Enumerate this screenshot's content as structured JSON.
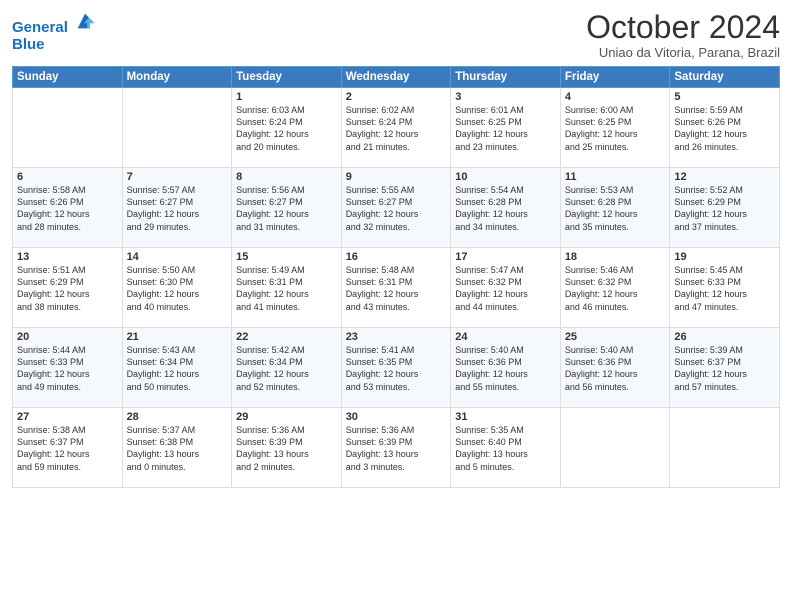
{
  "logo": {
    "line1": "General",
    "line2": "Blue"
  },
  "title": "October 2024",
  "subtitle": "Uniao da Vitoria, Parana, Brazil",
  "days_of_week": [
    "Sunday",
    "Monday",
    "Tuesday",
    "Wednesday",
    "Thursday",
    "Friday",
    "Saturday"
  ],
  "weeks": [
    [
      {
        "day": "",
        "content": ""
      },
      {
        "day": "",
        "content": ""
      },
      {
        "day": "1",
        "content": "Sunrise: 6:03 AM\nSunset: 6:24 PM\nDaylight: 12 hours\nand 20 minutes."
      },
      {
        "day": "2",
        "content": "Sunrise: 6:02 AM\nSunset: 6:24 PM\nDaylight: 12 hours\nand 21 minutes."
      },
      {
        "day": "3",
        "content": "Sunrise: 6:01 AM\nSunset: 6:25 PM\nDaylight: 12 hours\nand 23 minutes."
      },
      {
        "day": "4",
        "content": "Sunrise: 6:00 AM\nSunset: 6:25 PM\nDaylight: 12 hours\nand 25 minutes."
      },
      {
        "day": "5",
        "content": "Sunrise: 5:59 AM\nSunset: 6:26 PM\nDaylight: 12 hours\nand 26 minutes."
      }
    ],
    [
      {
        "day": "6",
        "content": "Sunrise: 5:58 AM\nSunset: 6:26 PM\nDaylight: 12 hours\nand 28 minutes."
      },
      {
        "day": "7",
        "content": "Sunrise: 5:57 AM\nSunset: 6:27 PM\nDaylight: 12 hours\nand 29 minutes."
      },
      {
        "day": "8",
        "content": "Sunrise: 5:56 AM\nSunset: 6:27 PM\nDaylight: 12 hours\nand 31 minutes."
      },
      {
        "day": "9",
        "content": "Sunrise: 5:55 AM\nSunset: 6:27 PM\nDaylight: 12 hours\nand 32 minutes."
      },
      {
        "day": "10",
        "content": "Sunrise: 5:54 AM\nSunset: 6:28 PM\nDaylight: 12 hours\nand 34 minutes."
      },
      {
        "day": "11",
        "content": "Sunrise: 5:53 AM\nSunset: 6:28 PM\nDaylight: 12 hours\nand 35 minutes."
      },
      {
        "day": "12",
        "content": "Sunrise: 5:52 AM\nSunset: 6:29 PM\nDaylight: 12 hours\nand 37 minutes."
      }
    ],
    [
      {
        "day": "13",
        "content": "Sunrise: 5:51 AM\nSunset: 6:29 PM\nDaylight: 12 hours\nand 38 minutes."
      },
      {
        "day": "14",
        "content": "Sunrise: 5:50 AM\nSunset: 6:30 PM\nDaylight: 12 hours\nand 40 minutes."
      },
      {
        "day": "15",
        "content": "Sunrise: 5:49 AM\nSunset: 6:31 PM\nDaylight: 12 hours\nand 41 minutes."
      },
      {
        "day": "16",
        "content": "Sunrise: 5:48 AM\nSunset: 6:31 PM\nDaylight: 12 hours\nand 43 minutes."
      },
      {
        "day": "17",
        "content": "Sunrise: 5:47 AM\nSunset: 6:32 PM\nDaylight: 12 hours\nand 44 minutes."
      },
      {
        "day": "18",
        "content": "Sunrise: 5:46 AM\nSunset: 6:32 PM\nDaylight: 12 hours\nand 46 minutes."
      },
      {
        "day": "19",
        "content": "Sunrise: 5:45 AM\nSunset: 6:33 PM\nDaylight: 12 hours\nand 47 minutes."
      }
    ],
    [
      {
        "day": "20",
        "content": "Sunrise: 5:44 AM\nSunset: 6:33 PM\nDaylight: 12 hours\nand 49 minutes."
      },
      {
        "day": "21",
        "content": "Sunrise: 5:43 AM\nSunset: 6:34 PM\nDaylight: 12 hours\nand 50 minutes."
      },
      {
        "day": "22",
        "content": "Sunrise: 5:42 AM\nSunset: 6:34 PM\nDaylight: 12 hours\nand 52 minutes."
      },
      {
        "day": "23",
        "content": "Sunrise: 5:41 AM\nSunset: 6:35 PM\nDaylight: 12 hours\nand 53 minutes."
      },
      {
        "day": "24",
        "content": "Sunrise: 5:40 AM\nSunset: 6:36 PM\nDaylight: 12 hours\nand 55 minutes."
      },
      {
        "day": "25",
        "content": "Sunrise: 5:40 AM\nSunset: 6:36 PM\nDaylight: 12 hours\nand 56 minutes."
      },
      {
        "day": "26",
        "content": "Sunrise: 5:39 AM\nSunset: 6:37 PM\nDaylight: 12 hours\nand 57 minutes."
      }
    ],
    [
      {
        "day": "27",
        "content": "Sunrise: 5:38 AM\nSunset: 6:37 PM\nDaylight: 12 hours\nand 59 minutes."
      },
      {
        "day": "28",
        "content": "Sunrise: 5:37 AM\nSunset: 6:38 PM\nDaylight: 13 hours\nand 0 minutes."
      },
      {
        "day": "29",
        "content": "Sunrise: 5:36 AM\nSunset: 6:39 PM\nDaylight: 13 hours\nand 2 minutes."
      },
      {
        "day": "30",
        "content": "Sunrise: 5:36 AM\nSunset: 6:39 PM\nDaylight: 13 hours\nand 3 minutes."
      },
      {
        "day": "31",
        "content": "Sunrise: 5:35 AM\nSunset: 6:40 PM\nDaylight: 13 hours\nand 5 minutes."
      },
      {
        "day": "",
        "content": ""
      },
      {
        "day": "",
        "content": ""
      }
    ]
  ]
}
